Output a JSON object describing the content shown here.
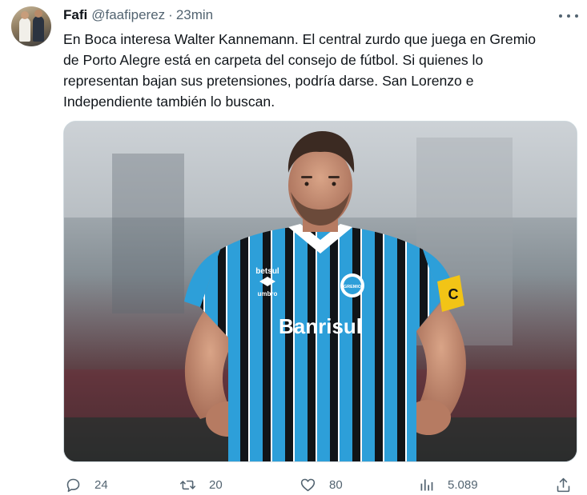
{
  "tweet": {
    "author_name": "Fafi",
    "handle": "@faafiperez",
    "separator": "·",
    "time": "23min",
    "text_lines": [
      "En Boca interesa Walter Kannemann. El central zurdo que juega en Gremio",
      "de Porto Alegre está en carpeta del consejo de fútbol. Si quienes lo",
      "representan bajan sus pretensiones, podría darse. San Lorenzo e",
      "Independiente también lo buscan."
    ],
    "media": {
      "sponsor_text": "Banrisul",
      "kit_brand": "betsul",
      "maker": "umbro",
      "club_badge": "GREMIO",
      "captain_letter": "C"
    }
  },
  "actions": {
    "reply_count": "24",
    "retweet_count": "20",
    "like_count": "80",
    "views_count": "5.089"
  },
  "icons": {
    "more": "more-horizontal-icon",
    "reply": "reply-icon",
    "retweet": "retweet-icon",
    "like": "heart-icon",
    "views": "views-chart-icon",
    "share": "share-icon"
  },
  "colors": {
    "text_primary": "#0f1419",
    "text_secondary": "#536471",
    "border": "#cfd9de",
    "gremio_blue": "#2d9fd9",
    "gremio_black": "#111418",
    "captain_band": "#f2c416"
  }
}
